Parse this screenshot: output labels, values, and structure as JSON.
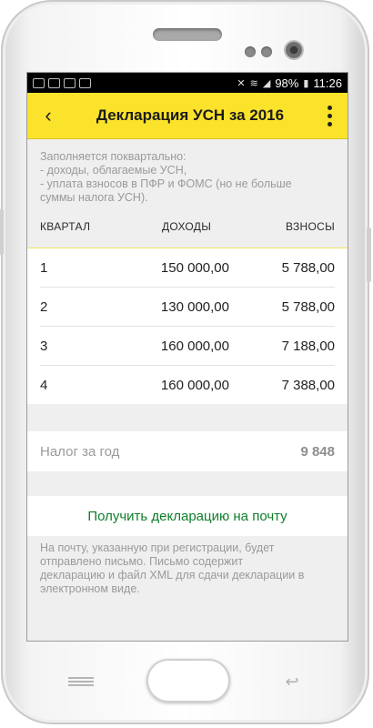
{
  "status_bar": {
    "notification_icons": [
      "",
      "",
      "",
      ""
    ],
    "battery": "98%",
    "time": "11:26"
  },
  "app_bar": {
    "title": "Декларация УСН за 2016"
  },
  "intro": {
    "lines": [
      "Заполняется поквартально:",
      "- доходы, облагаемые УСН,",
      "- уплата взносов в ПФР и ФОМС (но не больше",
      "суммы налога УСН)."
    ]
  },
  "table": {
    "headers": {
      "quarter": "КВАРТАЛ",
      "income": "ДОХОДЫ",
      "payments": "ВЗНОСЫ"
    },
    "rows": [
      {
        "quarter": "1",
        "income": "150 000,00",
        "payments": "5 788,00"
      },
      {
        "quarter": "2",
        "income": "130 000,00",
        "payments": "5 788,00"
      },
      {
        "quarter": "3",
        "income": "160 000,00",
        "payments": "7 188,00"
      },
      {
        "quarter": "4",
        "income": "160 000,00",
        "payments": "7 388,00"
      }
    ]
  },
  "total": {
    "label": "Налог за год",
    "value": "9 848"
  },
  "action": {
    "label": "Получить декларацию на почту"
  },
  "footnote": {
    "lines": [
      "На почту, указанную при регистрации, будет",
      "отправлено письмо. Письмо содержит",
      "декларацию и файл XML для сдачи декларации в",
      "электронном виде."
    ]
  },
  "colors": {
    "accent": "#fbe32b",
    "action_text": "#0e7e2a"
  }
}
